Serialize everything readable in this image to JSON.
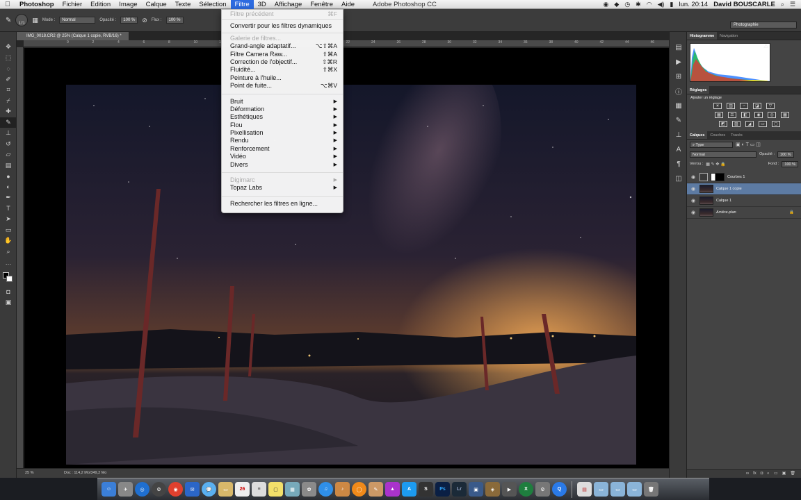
{
  "menubar": {
    "apple": "",
    "items": [
      "Photoshop",
      "Fichier",
      "Edition",
      "Image",
      "Calque",
      "Texte",
      "Sélection",
      "Filtre",
      "3D",
      "Affichage",
      "Fenêtre",
      "Aide"
    ],
    "window_title": "Adobe Photoshop CC",
    "clock": "lun. 20:14",
    "user": "David BOUSCARLE"
  },
  "options_bar": {
    "brush_size": "171",
    "mode_label": "Mode :",
    "mode_value": "Normal",
    "opacity_label": "Opacité :",
    "opacity_value": "100 %",
    "flux_label": "Flux :",
    "flux_value": "100 %",
    "workspace": "Photographie"
  },
  "document": {
    "tab_title": "IMG_0018.CR2 @ 25% (Calque 1 copie, RVB/16) *",
    "zoom": "25 %",
    "doc_info": "Doc : 114,2 Mo/349,2 Mo",
    "ruler_ticks": [
      "0",
      "2",
      "4",
      "6",
      "8",
      "10",
      "12",
      "14",
      "16",
      "18",
      "20",
      "22",
      "24",
      "26",
      "28",
      "30",
      "32",
      "34",
      "36",
      "38",
      "40",
      "42",
      "44",
      "46",
      "48"
    ]
  },
  "filter_menu": {
    "last_filter": "Filtre précédent",
    "last_filter_shortcut": "⌘F",
    "convert": "Convertir pour les filtres dynamiques",
    "gallery": "Galerie de filtres...",
    "wide_angle": "Grand-angle adaptatif...",
    "wide_angle_shortcut": "⌥⇧⌘A",
    "camera_raw": "Filtre Camera Raw...",
    "camera_raw_shortcut": "⇧⌘A",
    "lens": "Correction de l'objectif...",
    "lens_shortcut": "⇧⌘R",
    "liquify": "Fluidité...",
    "liquify_shortcut": "⇧⌘X",
    "oil": "Peinture à l'huile...",
    "vanish": "Point de fuite...",
    "vanish_shortcut": "⌥⌘V",
    "submenus": [
      "Bruit",
      "Déformation",
      "Esthétiques",
      "Flou",
      "Pixellisation",
      "Rendu",
      "Renforcement",
      "Vidéo",
      "Divers"
    ],
    "digimarc": "Digimarc",
    "topaz": "Topaz Labs",
    "online": "Rechercher les filtres en ligne..."
  },
  "panels": {
    "histogram_tabs": [
      "Histogramme",
      "Navigation"
    ],
    "adjust_tab": "Réglages",
    "adjust_add": "Ajouter un réglage",
    "layer_tabs": [
      "Calques",
      "Couches",
      "Tracés"
    ],
    "filter_kind": "Type",
    "blend_mode": "Normal",
    "opacity_label": "Opacité :",
    "opacity_value": "100 %",
    "lock_label": "Verrou :",
    "fill_label": "Fond :",
    "fill_value": "100 %",
    "layers": [
      "Courbes 1",
      "Calque 1 copie",
      "Calque 1",
      "Arrière-plan"
    ]
  },
  "colors": {
    "menu_highlight": "#2d6be0",
    "selected_layer": "#5d7ba3"
  }
}
